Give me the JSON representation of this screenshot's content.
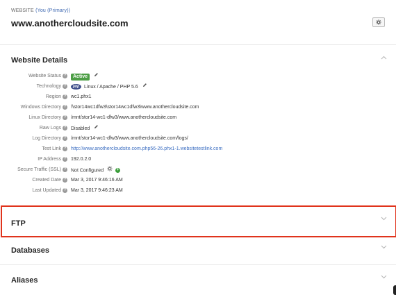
{
  "header": {
    "eyebrow_label": "WEBSITE",
    "eyebrow_owner": "(You (Primary))",
    "site_name": "www.anothercloudsite.com",
    "settings_icon": "gear-icon"
  },
  "details": {
    "title": "Website Details",
    "rows": [
      {
        "label": "Website Status",
        "value": "Active"
      },
      {
        "label": "Technology",
        "value": "Linux / Apache / PHP 5.6"
      },
      {
        "label": "Region",
        "value": "wc1.phx1"
      },
      {
        "label": "Windows Directory",
        "value": "\\\\stor14wc1dfw3\\stor14wc1dfw3\\www.anothercloudsite.com"
      },
      {
        "label": "Linux Directory",
        "value": "/mnt/stor14-wc1-dfw3/www.anothercloudsite.com"
      },
      {
        "label": "Raw Logs",
        "value": "Disabled"
      },
      {
        "label": "Log Directory",
        "value": "/mnt/stor14-wc1-dfw3/www.anothercloudsite.com/logs/"
      },
      {
        "label": "Test Link",
        "value": "http://www.anothercloudsite.com.php56-26.phx1-1.websitetestlink.com"
      },
      {
        "label": "IP Address",
        "value": "192.0.2.0"
      },
      {
        "label": "Secure Traffic (SSL)",
        "value": "Not Configured"
      },
      {
        "label": "Created Date",
        "value": "Mar 3, 2017 9:46:16 AM"
      },
      {
        "label": "Last Updated",
        "value": "Mar 3, 2017 9:46:23 AM"
      }
    ],
    "help_glyph": "?",
    "php_logo_text": "php",
    "ssl_plus_glyph": "+"
  },
  "sections": {
    "ftp": "FTP",
    "databases": "Databases",
    "aliases": "Aliases"
  },
  "colors": {
    "accent_link": "#3d6fc2",
    "status_active": "#4c9e45",
    "highlight_border": "#e0331c"
  }
}
